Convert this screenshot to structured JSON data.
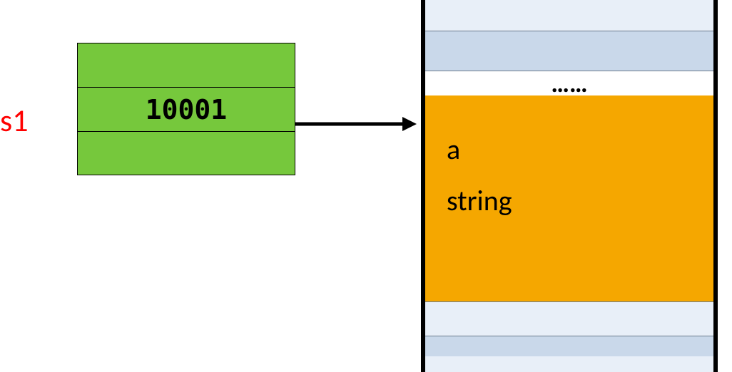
{
  "variable": {
    "name": "s1"
  },
  "stack": {
    "value": "10001"
  },
  "memory": {
    "ellipsis": "……",
    "heap_line1": "a",
    "heap_line2": "string"
  }
}
